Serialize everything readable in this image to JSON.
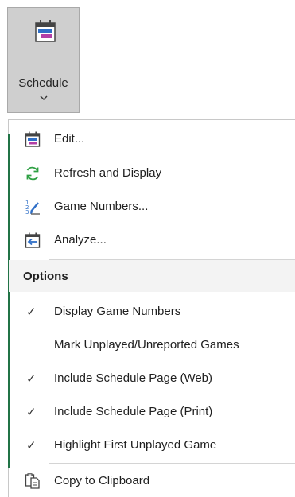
{
  "ribbon": {
    "button_label": "Schedule"
  },
  "menu": {
    "items": [
      {
        "label": "Edit...",
        "icon": "calendar-edit-icon"
      },
      {
        "label": "Refresh and Display",
        "icon": "refresh-icon"
      },
      {
        "label": "Game Numbers...",
        "icon": "numbered-list-edit-icon"
      },
      {
        "label": "Analyze...",
        "icon": "calendar-analyze-icon"
      }
    ],
    "options_header": "Options",
    "options": [
      {
        "label": "Display Game Numbers",
        "checked": true
      },
      {
        "label": "Mark Unplayed/Unreported Games",
        "checked": false
      },
      {
        "label": "Include Schedule Page (Web)",
        "checked": true
      },
      {
        "label": "Include Schedule Page (Print)",
        "checked": true
      },
      {
        "label": "Highlight First Unplayed Game",
        "checked": true
      }
    ],
    "footer_item": {
      "label": "Copy to Clipboard",
      "icon": "copy-to-clipboard-icon"
    }
  },
  "colors": {
    "accent_green": "#217346",
    "icon_blue": "#2f6fc7",
    "icon_magenta": "#b33fa6",
    "refresh_green": "#2ea043"
  }
}
